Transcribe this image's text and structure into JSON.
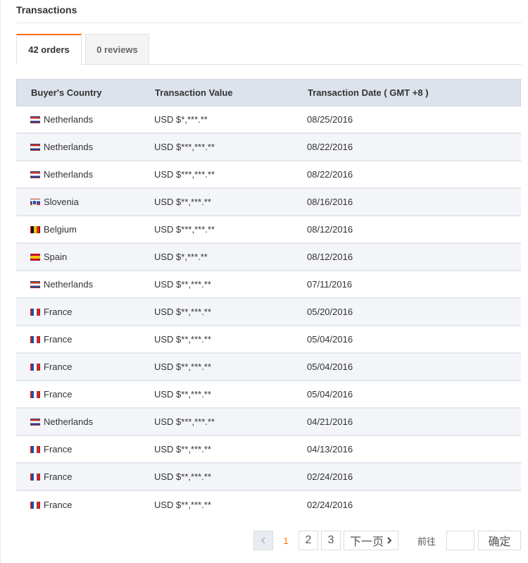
{
  "section": {
    "title": "Transactions"
  },
  "tabs": [
    {
      "label": "42 orders",
      "active": true
    },
    {
      "label": "0 reviews",
      "active": false
    }
  ],
  "table": {
    "headers": [
      "Buyer's Country",
      "Transaction Value",
      "Transaction Date ( GMT +8 )"
    ],
    "rows": [
      {
        "flag": "nl-flag-icon",
        "country": "Netherlands",
        "value": "USD $*,***.**",
        "date": "08/25/2016"
      },
      {
        "flag": "nl-flag-icon",
        "country": "Netherlands",
        "value": "USD $***,***.**",
        "date": "08/22/2016"
      },
      {
        "flag": "nl-flag-icon",
        "country": "Netherlands",
        "value": "USD $***,***.**",
        "date": "08/22/2016"
      },
      {
        "flag": "si-flag-icon",
        "country": "Slovenia",
        "value": "USD $**,***.**",
        "date": "08/16/2016"
      },
      {
        "flag": "be-flag-icon",
        "country": "Belgium",
        "value": "USD $***,***.**",
        "date": "08/12/2016"
      },
      {
        "flag": "es-flag-icon",
        "country": "Spain",
        "value": "USD $*,***.**",
        "date": "08/12/2016"
      },
      {
        "flag": "nl-flag-icon",
        "country": "Netherlands",
        "value": "USD $**,***.**",
        "date": "07/11/2016"
      },
      {
        "flag": "fr-flag-icon",
        "country": "France",
        "value": "USD $**,***.**",
        "date": "05/20/2016"
      },
      {
        "flag": "fr-flag-icon",
        "country": "France",
        "value": "USD $**,***.**",
        "date": "05/04/2016"
      },
      {
        "flag": "fr-flag-icon",
        "country": "France",
        "value": "USD $**,***.**",
        "date": "05/04/2016"
      },
      {
        "flag": "fr-flag-icon",
        "country": "France",
        "value": "USD $**,***.**",
        "date": "05/04/2016"
      },
      {
        "flag": "nl-flag-icon",
        "country": "Netherlands",
        "value": "USD $***,***.**",
        "date": "04/21/2016"
      },
      {
        "flag": "fr-flag-icon",
        "country": "France",
        "value": "USD $**,***.**",
        "date": "04/13/2016"
      },
      {
        "flag": "fr-flag-icon",
        "country": "France",
        "value": "USD $**,***.**",
        "date": "02/24/2016"
      },
      {
        "flag": "fr-flag-icon",
        "country": "France",
        "value": "USD $**,***.**",
        "date": "02/24/2016"
      }
    ]
  },
  "pagination": {
    "prev_icon": "chevron-left-icon",
    "pages": [
      "1",
      "2",
      "3"
    ],
    "current": "1",
    "next_label": "下一页",
    "next_icon": "chevron-right-icon",
    "goto_label": "前往",
    "goto_value": "",
    "confirm_label": "确定"
  },
  "colors": {
    "accent": "#ff6a00",
    "header_bg": "#dde3ec",
    "alt_row": "#f3f5f9"
  }
}
